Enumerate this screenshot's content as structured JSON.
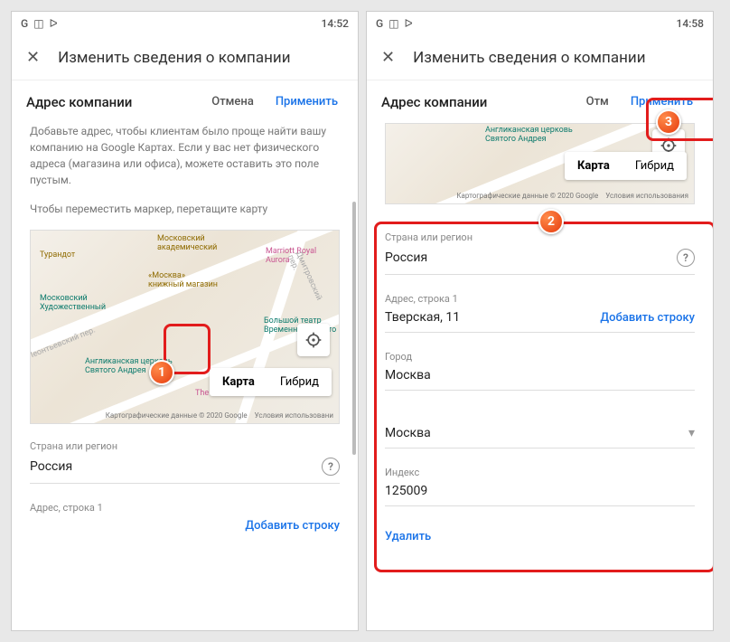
{
  "left": {
    "status_time": "14:52",
    "header_title": "Изменить сведения о компании",
    "section_title": "Адрес компании",
    "cancel": "Отмена",
    "apply": "Применить",
    "help1": "Добавьте адрес, чтобы клиентам было проще найти вашу компанию на Google Картах. Если у вас нет физического адреса (магазина или офиса), можете оставить это поле пустым.",
    "help2": "Чтобы переместить маркер, перетащите карту",
    "map_tab_map": "Карта",
    "map_tab_hybrid": "Гибрид",
    "map_copy": "Картографические данные © 2020 Google",
    "map_terms": "Условия использовани",
    "poi_univ": "Московский\nакадемический",
    "poi_marriott": "Marriott Royal Aurora",
    "poi_moscow": "«Москва»\nкнижный магазин",
    "poi_museum": "Московский\nХудожественный",
    "poi_bolshoi": "Большой театр\nВременно закрыто",
    "poi_church": "Англиканская церковь\nСвятого Андрея",
    "poi_turandot": "Турандот",
    "poi_theR": "The R",
    "poi_dmitr": "Дмитровский пер.",
    "poi_leont": "Леонтьевский пер.",
    "fields": {
      "country_label": "Страна или регион",
      "country_val": "Россия",
      "addr1_label": "Адрес, строка 1",
      "add_line": "Добавить строку"
    },
    "badge": "1"
  },
  "right": {
    "status_time": "14:58",
    "header_title": "Изменить сведения о компании",
    "section_title": "Адрес компании",
    "cancel": "Отм",
    "apply": "Применить",
    "map_tab_map": "Карта",
    "map_tab_hybrid": "Гибрид",
    "map_copy": "Картографические данные © 2020 Google",
    "map_terms": "Условия использования",
    "poi_church2": "Англиканская церковь\nСвятого Андрея",
    "fields": {
      "country_label": "Страна или регион",
      "country_val": "Россия",
      "addr1_label": "Адрес, строка 1",
      "addr1_val": "Тверская, 11",
      "add_line": "Добавить строку",
      "city_label": "Город",
      "city_val": "Москва",
      "region_val": "Москва",
      "zip_label": "Индекс",
      "zip_val": "125009"
    },
    "delete": "Удалить",
    "badge_form": "2",
    "badge_apply": "3"
  }
}
